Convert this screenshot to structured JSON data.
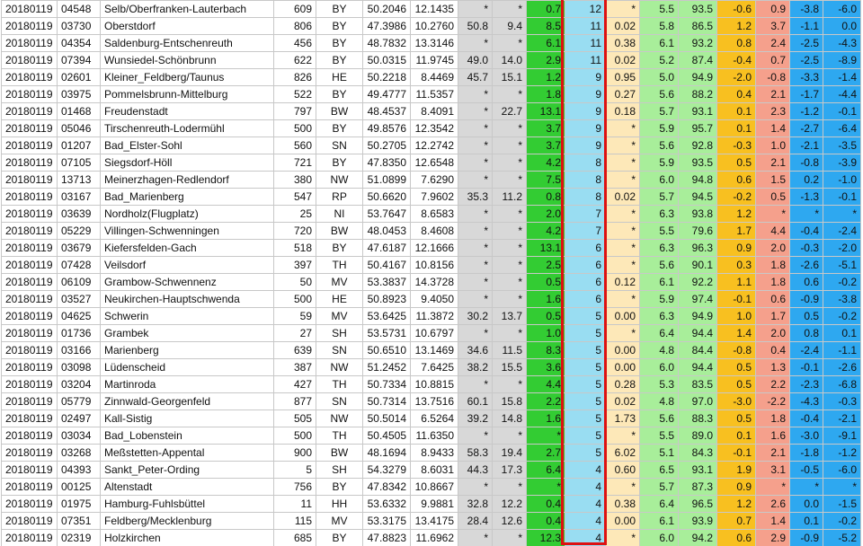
{
  "table": {
    "rows": [
      [
        "20180119",
        "04548",
        "Selb/Oberfranken-Lauterbach",
        "609",
        "BY",
        "50.2046",
        "12.1435",
        "*",
        "*",
        "0.7",
        "12",
        "*",
        "5.5",
        "93.5",
        "-0.6",
        "0.9",
        "-3.8",
        "-6.0"
      ],
      [
        "20180119",
        "03730",
        "Oberstdorf",
        "806",
        "BY",
        "47.3986",
        "10.2760",
        "50.8",
        "9.4",
        "8.5",
        "11",
        "0.02",
        "5.8",
        "86.5",
        "1.2",
        "3.7",
        "-1.1",
        "0.0"
      ],
      [
        "20180119",
        "04354",
        "Saldenburg-Entschenreuth",
        "456",
        "BY",
        "48.7832",
        "13.3146",
        "*",
        "*",
        "6.1",
        "11",
        "0.38",
        "6.1",
        "93.2",
        "0.8",
        "2.4",
        "-2.5",
        "-4.3"
      ],
      [
        "20180119",
        "07394",
        "Wunsiedel-Schönbrunn",
        "622",
        "BY",
        "50.0315",
        "11.9745",
        "49.0",
        "14.0",
        "2.9",
        "11",
        "0.02",
        "5.2",
        "87.4",
        "-0.4",
        "0.7",
        "-2.5",
        "-8.9"
      ],
      [
        "20180119",
        "02601",
        "Kleiner_Feldberg/Taunus",
        "826",
        "HE",
        "50.2218",
        "8.4469",
        "45.7",
        "15.1",
        "1.2",
        "9",
        "0.95",
        "5.0",
        "94.9",
        "-2.0",
        "-0.8",
        "-3.3",
        "-1.4"
      ],
      [
        "20180119",
        "03975",
        "Pommelsbrunn-Mittelburg",
        "522",
        "BY",
        "49.4777",
        "11.5357",
        "*",
        "*",
        "1.8",
        "9",
        "0.27",
        "5.6",
        "88.2",
        "0.4",
        "2.1",
        "-1.7",
        "-4.4"
      ],
      [
        "20180119",
        "01468",
        "Freudenstadt",
        "797",
        "BW",
        "48.4537",
        "8.4091",
        "*",
        "22.7",
        "13.1",
        "9",
        "0.18",
        "5.7",
        "93.1",
        "0.1",
        "2.3",
        "-1.2",
        "-0.1"
      ],
      [
        "20180119",
        "05046",
        "Tirschenreuth-Lodermühl",
        "500",
        "BY",
        "49.8576",
        "12.3542",
        "*",
        "*",
        "3.7",
        "9",
        "*",
        "5.9",
        "95.7",
        "0.1",
        "1.4",
        "-2.7",
        "-6.4"
      ],
      [
        "20180119",
        "01207",
        "Bad_Elster-Sohl",
        "560",
        "SN",
        "50.2705",
        "12.2742",
        "*",
        "*",
        "3.7",
        "9",
        "*",
        "5.6",
        "92.8",
        "-0.3",
        "1.0",
        "-2.1",
        "-3.5"
      ],
      [
        "20180119",
        "07105",
        "Siegsdorf-Höll",
        "721",
        "BY",
        "47.8350",
        "12.6548",
        "*",
        "*",
        "4.2",
        "8",
        "*",
        "5.9",
        "93.5",
        "0.5",
        "2.1",
        "-0.8",
        "-3.9"
      ],
      [
        "20180119",
        "13713",
        "Meinerzhagen-Redlendorf",
        "380",
        "NW",
        "51.0899",
        "7.6290",
        "*",
        "*",
        "7.5",
        "8",
        "*",
        "6.0",
        "94.8",
        "0.6",
        "1.5",
        "0.2",
        "-1.0"
      ],
      [
        "20180119",
        "03167",
        "Bad_Marienberg",
        "547",
        "RP",
        "50.6620",
        "7.9602",
        "35.3",
        "11.2",
        "0.8",
        "8",
        "0.02",
        "5.7",
        "94.5",
        "-0.2",
        "0.5",
        "-1.3",
        "-0.1"
      ],
      [
        "20180119",
        "03639",
        "Nordholz(Flugplatz)",
        "25",
        "NI",
        "53.7647",
        "8.6583",
        "*",
        "*",
        "2.0",
        "7",
        "*",
        "6.3",
        "93.8",
        "1.2",
        "*",
        "*",
        "*"
      ],
      [
        "20180119",
        "05229",
        "Villingen-Schwenningen",
        "720",
        "BW",
        "48.0453",
        "8.4608",
        "*",
        "*",
        "4.2",
        "7",
        "*",
        "5.5",
        "79.6",
        "1.7",
        "4.4",
        "-0.4",
        "-2.4"
      ],
      [
        "20180119",
        "03679",
        "Kiefersfelden-Gach",
        "518",
        "BY",
        "47.6187",
        "12.1666",
        "*",
        "*",
        "13.1",
        "6",
        "*",
        "6.3",
        "96.3",
        "0.9",
        "2.0",
        "-0.3",
        "-2.0"
      ],
      [
        "20180119",
        "07428",
        "Veilsdorf",
        "397",
        "TH",
        "50.4167",
        "10.8156",
        "*",
        "*",
        "2.5",
        "6",
        "*",
        "5.6",
        "90.1",
        "0.3",
        "1.8",
        "-2.6",
        "-5.1"
      ],
      [
        "20180119",
        "06109",
        "Grambow-Schwennenz",
        "50",
        "MV",
        "53.3837",
        "14.3728",
        "*",
        "*",
        "0.5",
        "6",
        "0.12",
        "6.1",
        "92.2",
        "1.1",
        "1.8",
        "0.6",
        "-0.2"
      ],
      [
        "20180119",
        "03527",
        "Neukirchen-Hauptschwenda",
        "500",
        "HE",
        "50.8923",
        "9.4050",
        "*",
        "*",
        "1.6",
        "6",
        "*",
        "5.9",
        "97.4",
        "-0.1",
        "0.6",
        "-0.9",
        "-3.8"
      ],
      [
        "20180119",
        "04625",
        "Schwerin",
        "59",
        "MV",
        "53.6425",
        "11.3872",
        "30.2",
        "13.7",
        "0.5",
        "5",
        "0.00",
        "6.3",
        "94.9",
        "1.0",
        "1.7",
        "0.5",
        "-0.2"
      ],
      [
        "20180119",
        "01736",
        "Grambek",
        "27",
        "SH",
        "53.5731",
        "10.6797",
        "*",
        "*",
        "1.0",
        "5",
        "*",
        "6.4",
        "94.4",
        "1.4",
        "2.0",
        "0.8",
        "0.1"
      ],
      [
        "20180119",
        "03166",
        "Marienberg",
        "639",
        "SN",
        "50.6510",
        "13.1469",
        "34.6",
        "11.5",
        "8.3",
        "5",
        "0.00",
        "4.8",
        "84.4",
        "-0.8",
        "0.4",
        "-2.4",
        "-1.1"
      ],
      [
        "20180119",
        "03098",
        "Lüdenscheid",
        "387",
        "NW",
        "51.2452",
        "7.6425",
        "38.2",
        "15.5",
        "3.6",
        "5",
        "0.00",
        "6.0",
        "94.4",
        "0.5",
        "1.3",
        "-0.1",
        "-2.6"
      ],
      [
        "20180119",
        "03204",
        "Martinroda",
        "427",
        "TH",
        "50.7334",
        "10.8815",
        "*",
        "*",
        "4.4",
        "5",
        "0.28",
        "5.3",
        "83.5",
        "0.5",
        "2.2",
        "-2.3",
        "-6.8"
      ],
      [
        "20180119",
        "05779",
        "Zinnwald-Georgenfeld",
        "877",
        "SN",
        "50.7314",
        "13.7516",
        "60.1",
        "15.8",
        "2.2",
        "5",
        "0.02",
        "4.8",
        "97.0",
        "-3.0",
        "-2.2",
        "-4.3",
        "-0.3"
      ],
      [
        "20180119",
        "02497",
        "Kall-Sistig",
        "505",
        "NW",
        "50.5014",
        "6.5264",
        "39.2",
        "14.8",
        "1.6",
        "5",
        "1.73",
        "5.6",
        "88.3",
        "0.5",
        "1.8",
        "-0.4",
        "-2.1"
      ],
      [
        "20180119",
        "03034",
        "Bad_Lobenstein",
        "500",
        "TH",
        "50.4505",
        "11.6350",
        "*",
        "*",
        "*",
        "5",
        "*",
        "5.5",
        "89.0",
        "0.1",
        "1.6",
        "-3.0",
        "-9.1"
      ],
      [
        "20180119",
        "03268",
        "Meßstetten-Appental",
        "900",
        "BW",
        "48.1694",
        "8.9433",
        "58.3",
        "19.4",
        "2.7",
        "5",
        "6.02",
        "5.1",
        "84.3",
        "-0.1",
        "2.1",
        "-1.8",
        "-1.2"
      ],
      [
        "20180119",
        "04393",
        "Sankt_Peter-Ording",
        "5",
        "SH",
        "54.3279",
        "8.6031",
        "44.3",
        "17.3",
        "6.4",
        "4",
        "0.60",
        "6.5",
        "93.1",
        "1.9",
        "3.1",
        "-0.5",
        "-6.0"
      ],
      [
        "20180119",
        "00125",
        "Altenstadt",
        "756",
        "BY",
        "47.8342",
        "10.8667",
        "*",
        "*",
        "*",
        "4",
        "*",
        "5.7",
        "87.3",
        "0.9",
        "*",
        "*",
        "*"
      ],
      [
        "20180119",
        "01975",
        "Hamburg-Fuhlsbüttel",
        "11",
        "HH",
        "53.6332",
        "9.9881",
        "32.8",
        "12.2",
        "0.4",
        "4",
        "0.38",
        "6.4",
        "96.5",
        "1.2",
        "2.6",
        "0.0",
        "-1.5"
      ],
      [
        "20180119",
        "07351",
        "Feldberg/Mecklenburg",
        "115",
        "MV",
        "53.3175",
        "13.4175",
        "28.4",
        "12.6",
        "0.4",
        "4",
        "0.00",
        "6.1",
        "93.9",
        "0.7",
        "1.4",
        "0.1",
        "-0.2"
      ],
      [
        "20180119",
        "02319",
        "Holzkirchen",
        "685",
        "BY",
        "47.8823",
        "11.6962",
        "*",
        "*",
        "12.3",
        "4",
        "*",
        "6.0",
        "94.2",
        "0.6",
        "2.9",
        "-0.9",
        "-5.2"
      ]
    ]
  },
  "column_colors": {
    "grey": "#d8d8d8",
    "green_wind": "#33cc33",
    "blue_highlighted": "#99ddf2",
    "cream": "#fde8b8",
    "light_green": "#a8ee9a",
    "orange": "#f8c020",
    "salmon": "#f5a08c",
    "blue": "#2ea8f0",
    "highlight_border": "#dd1111"
  }
}
